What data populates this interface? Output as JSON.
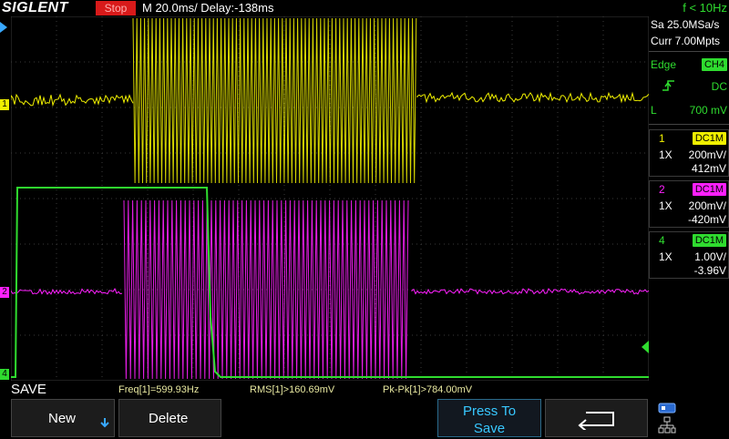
{
  "topbar": {
    "brand": "SIGLENT",
    "status": "Stop",
    "timebase": "M 20.0ms/ Delay:-138ms",
    "trigger_freq": "f < 10Hz"
  },
  "acquisition": {
    "sample_rate": "Sa 25.0MSa/s",
    "memory": "Curr 7.00Mpts"
  },
  "trigger": {
    "mode_label": "Edge",
    "source": "CH4",
    "coupling": "DC",
    "level_label": "L",
    "level": "700 mV"
  },
  "channels": [
    {
      "number": "1",
      "coupling": "DC1M",
      "probe": "1X",
      "scale": "200mV/",
      "offset": "412mV",
      "color": "#f0f000"
    },
    {
      "number": "2",
      "coupling": "DC1M",
      "probe": "1X",
      "scale": "200mV/",
      "offset": "-420mV",
      "color": "#ff20ff"
    },
    {
      "number": "4",
      "coupling": "DC1M",
      "probe": "1X",
      "scale": "1.00V/",
      "offset": "-3.96V",
      "color": "#2fdc2f"
    }
  ],
  "markers": {
    "ch1": "1",
    "ch2": "2",
    "ch4": "4"
  },
  "menu": {
    "title": "SAVE"
  },
  "measurements": {
    "freq": "Freq[1]=599.93Hz",
    "rms": "RMS[1]>160.69mV",
    "pkpk": "Pk-Pk[1]>784.00mV"
  },
  "softkeys": {
    "new_label": "New",
    "delete_label": "Delete",
    "press_to_save_line1": "Press To",
    "press_to_save_line2": "Save"
  },
  "icons": {
    "back": "return-arrow-icon",
    "usb": "usb-icon",
    "network": "network-icon",
    "new_arrow": "down-arrow-icon"
  },
  "colors": {
    "ch1": "#f0f000",
    "ch2": "#ff20ff",
    "ch4": "#2fdc2f",
    "status_stop": "#d81a1a",
    "grid": "#3a3a3a"
  }
}
